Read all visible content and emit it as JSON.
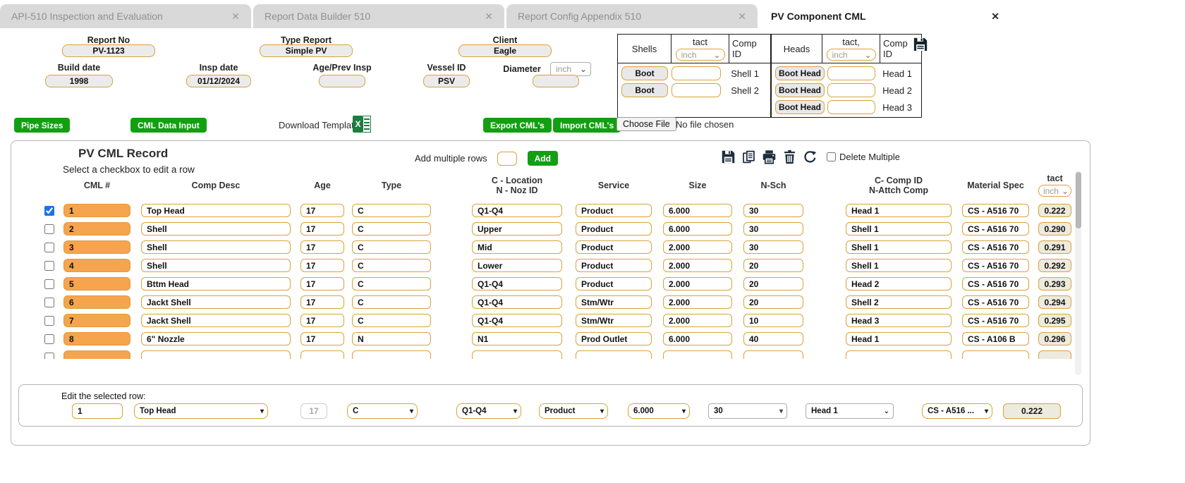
{
  "icons": {
    "close": "✕",
    "dropdown": "▾",
    "chevron": "⌄",
    "excel_x": "X"
  },
  "tabs": [
    {
      "label": "API-510 Inspection and Evaluation"
    },
    {
      "label": "Report Data Builder 510"
    },
    {
      "label": "Report Config Appendix 510"
    },
    {
      "label": "PV Component CML"
    }
  ],
  "header": {
    "report_no": {
      "label": "Report No",
      "value": "PV-1123"
    },
    "type_report": {
      "label": "Type Report",
      "value": "Simple PV"
    },
    "client": {
      "label": "Client",
      "value": "Eagle"
    },
    "build_date": {
      "label": "Build date",
      "value": "1998"
    },
    "insp_date": {
      "label": "Insp date",
      "value": "01/12/2024"
    },
    "age_prev": {
      "label": "Age/Prev Insp",
      "value": ""
    },
    "vessel_id": {
      "label": "Vessel ID",
      "value": "PSV"
    },
    "diameter": {
      "label": "Diameter",
      "unit": "inch",
      "value": ""
    }
  },
  "shells_heads": {
    "shells": {
      "title": "Shells",
      "tact": "tact",
      "unit": "inch",
      "comp": "Comp ID",
      "rows": [
        {
          "button": "Boot",
          "tact": "",
          "comp": "Shell 1"
        },
        {
          "button": "Boot",
          "tact": "",
          "comp": "Shell 2"
        }
      ]
    },
    "heads": {
      "title": "Heads",
      "tact": "tact,",
      "unit": "inch",
      "comp": "Comp ID",
      "rows": [
        {
          "button": "Boot Head",
          "tact": "",
          "comp": "Head 1"
        },
        {
          "button": "Boot Head",
          "tact": "",
          "comp": "Head 2"
        },
        {
          "button": "Boot Head",
          "tact": "",
          "comp": "Head 3"
        }
      ]
    }
  },
  "toolbar": {
    "pipe_sizes": "Pipe Sizes",
    "cml_data_input": "CML Data Input",
    "download_template": "Download Template",
    "export_cmls": "Export CML's",
    "import_cmls": "Import CML's",
    "choose_file": "Choose File",
    "no_file": "No file chosen"
  },
  "panel": {
    "title": "PV CML Record",
    "subtitle": "Select a checkbox to edit a row",
    "add_label": "Add multiple rows",
    "add_button": "Add",
    "delete_multiple": "Delete Multiple",
    "columns": {
      "cml": "CML #",
      "desc": "Comp Desc",
      "age": "Age",
      "type": "Type",
      "loc1": "C - Location",
      "loc2": "N - Noz ID",
      "service": "Service",
      "size": "Size",
      "nsch": "N-Sch",
      "comp1": "C- Comp ID",
      "comp2": "N-Attch Comp",
      "mat": "Material Spec",
      "tact": "tact",
      "tact_unit": "inch"
    },
    "rows": [
      {
        "checked": "checked",
        "cml": "1",
        "desc": "Top Head",
        "age": "17",
        "type": "C",
        "loc": "Q1-Q4",
        "service": "Product",
        "size": "6.000",
        "nsch": "30",
        "comp": "Head 1",
        "mat": "CS - A516 70",
        "tact": "0.222"
      },
      {
        "cml": "2",
        "desc": "Shell",
        "age": "17",
        "type": "C",
        "loc": "Upper",
        "service": "Product",
        "size": "6.000",
        "nsch": "30",
        "comp": "Shell 1",
        "mat": "CS - A516 70",
        "tact": "0.290"
      },
      {
        "cml": "3",
        "desc": "Shell",
        "age": "17",
        "type": "C",
        "loc": "Mid",
        "service": "Product",
        "size": "2.000",
        "nsch": "30",
        "comp": "Shell 1",
        "mat": "CS - A516 70",
        "tact": "0.291"
      },
      {
        "cml": "4",
        "desc": "Shell",
        "age": "17",
        "type": "C",
        "loc": "Lower",
        "service": "Product",
        "size": "2.000",
        "nsch": "20",
        "comp": "Shell 1",
        "mat": "CS - A516 70",
        "tact": "0.292"
      },
      {
        "cml": "5",
        "desc": "Bttm Head",
        "age": "17",
        "type": "C",
        "loc": "Q1-Q4",
        "service": "Product",
        "size": "2.000",
        "nsch": "20",
        "comp": "Head 2",
        "mat": "CS - A516 70",
        "tact": "0.293"
      },
      {
        "cml": "6",
        "desc": "Jackt Shell",
        "age": "17",
        "type": "C",
        "loc": "Q1-Q4",
        "service": "Stm/Wtr",
        "size": "2.000",
        "nsch": "20",
        "comp": "Shell 2",
        "mat": "CS - A516 70",
        "tact": "0.294"
      },
      {
        "cml": "7",
        "desc": "Jackt Shell",
        "age": "17",
        "type": "C",
        "loc": "Q1-Q4",
        "service": "Stm/Wtr",
        "size": "2.000",
        "nsch": "10",
        "comp": "Head 3",
        "mat": "CS - A516 70",
        "tact": "0.295"
      },
      {
        "cml": "8",
        "desc": "6\" Nozzle",
        "age": "17",
        "type": "N",
        "loc": "N1",
        "service": "Prod Outlet",
        "size": "6.000",
        "nsch": "40",
        "comp": "Head 1",
        "mat": "CS - A106 B",
        "tact": "0.296"
      }
    ]
  },
  "edit": {
    "label": "Edit the selected row:",
    "cml": "1",
    "desc": "Top Head",
    "age": "17",
    "type": "C",
    "loc": "Q1-Q4",
    "service": "Product",
    "size": "6.000",
    "nsch": "30",
    "comp": "Head 1",
    "mat": "CS - A516 ...",
    "tact": "0.222"
  }
}
